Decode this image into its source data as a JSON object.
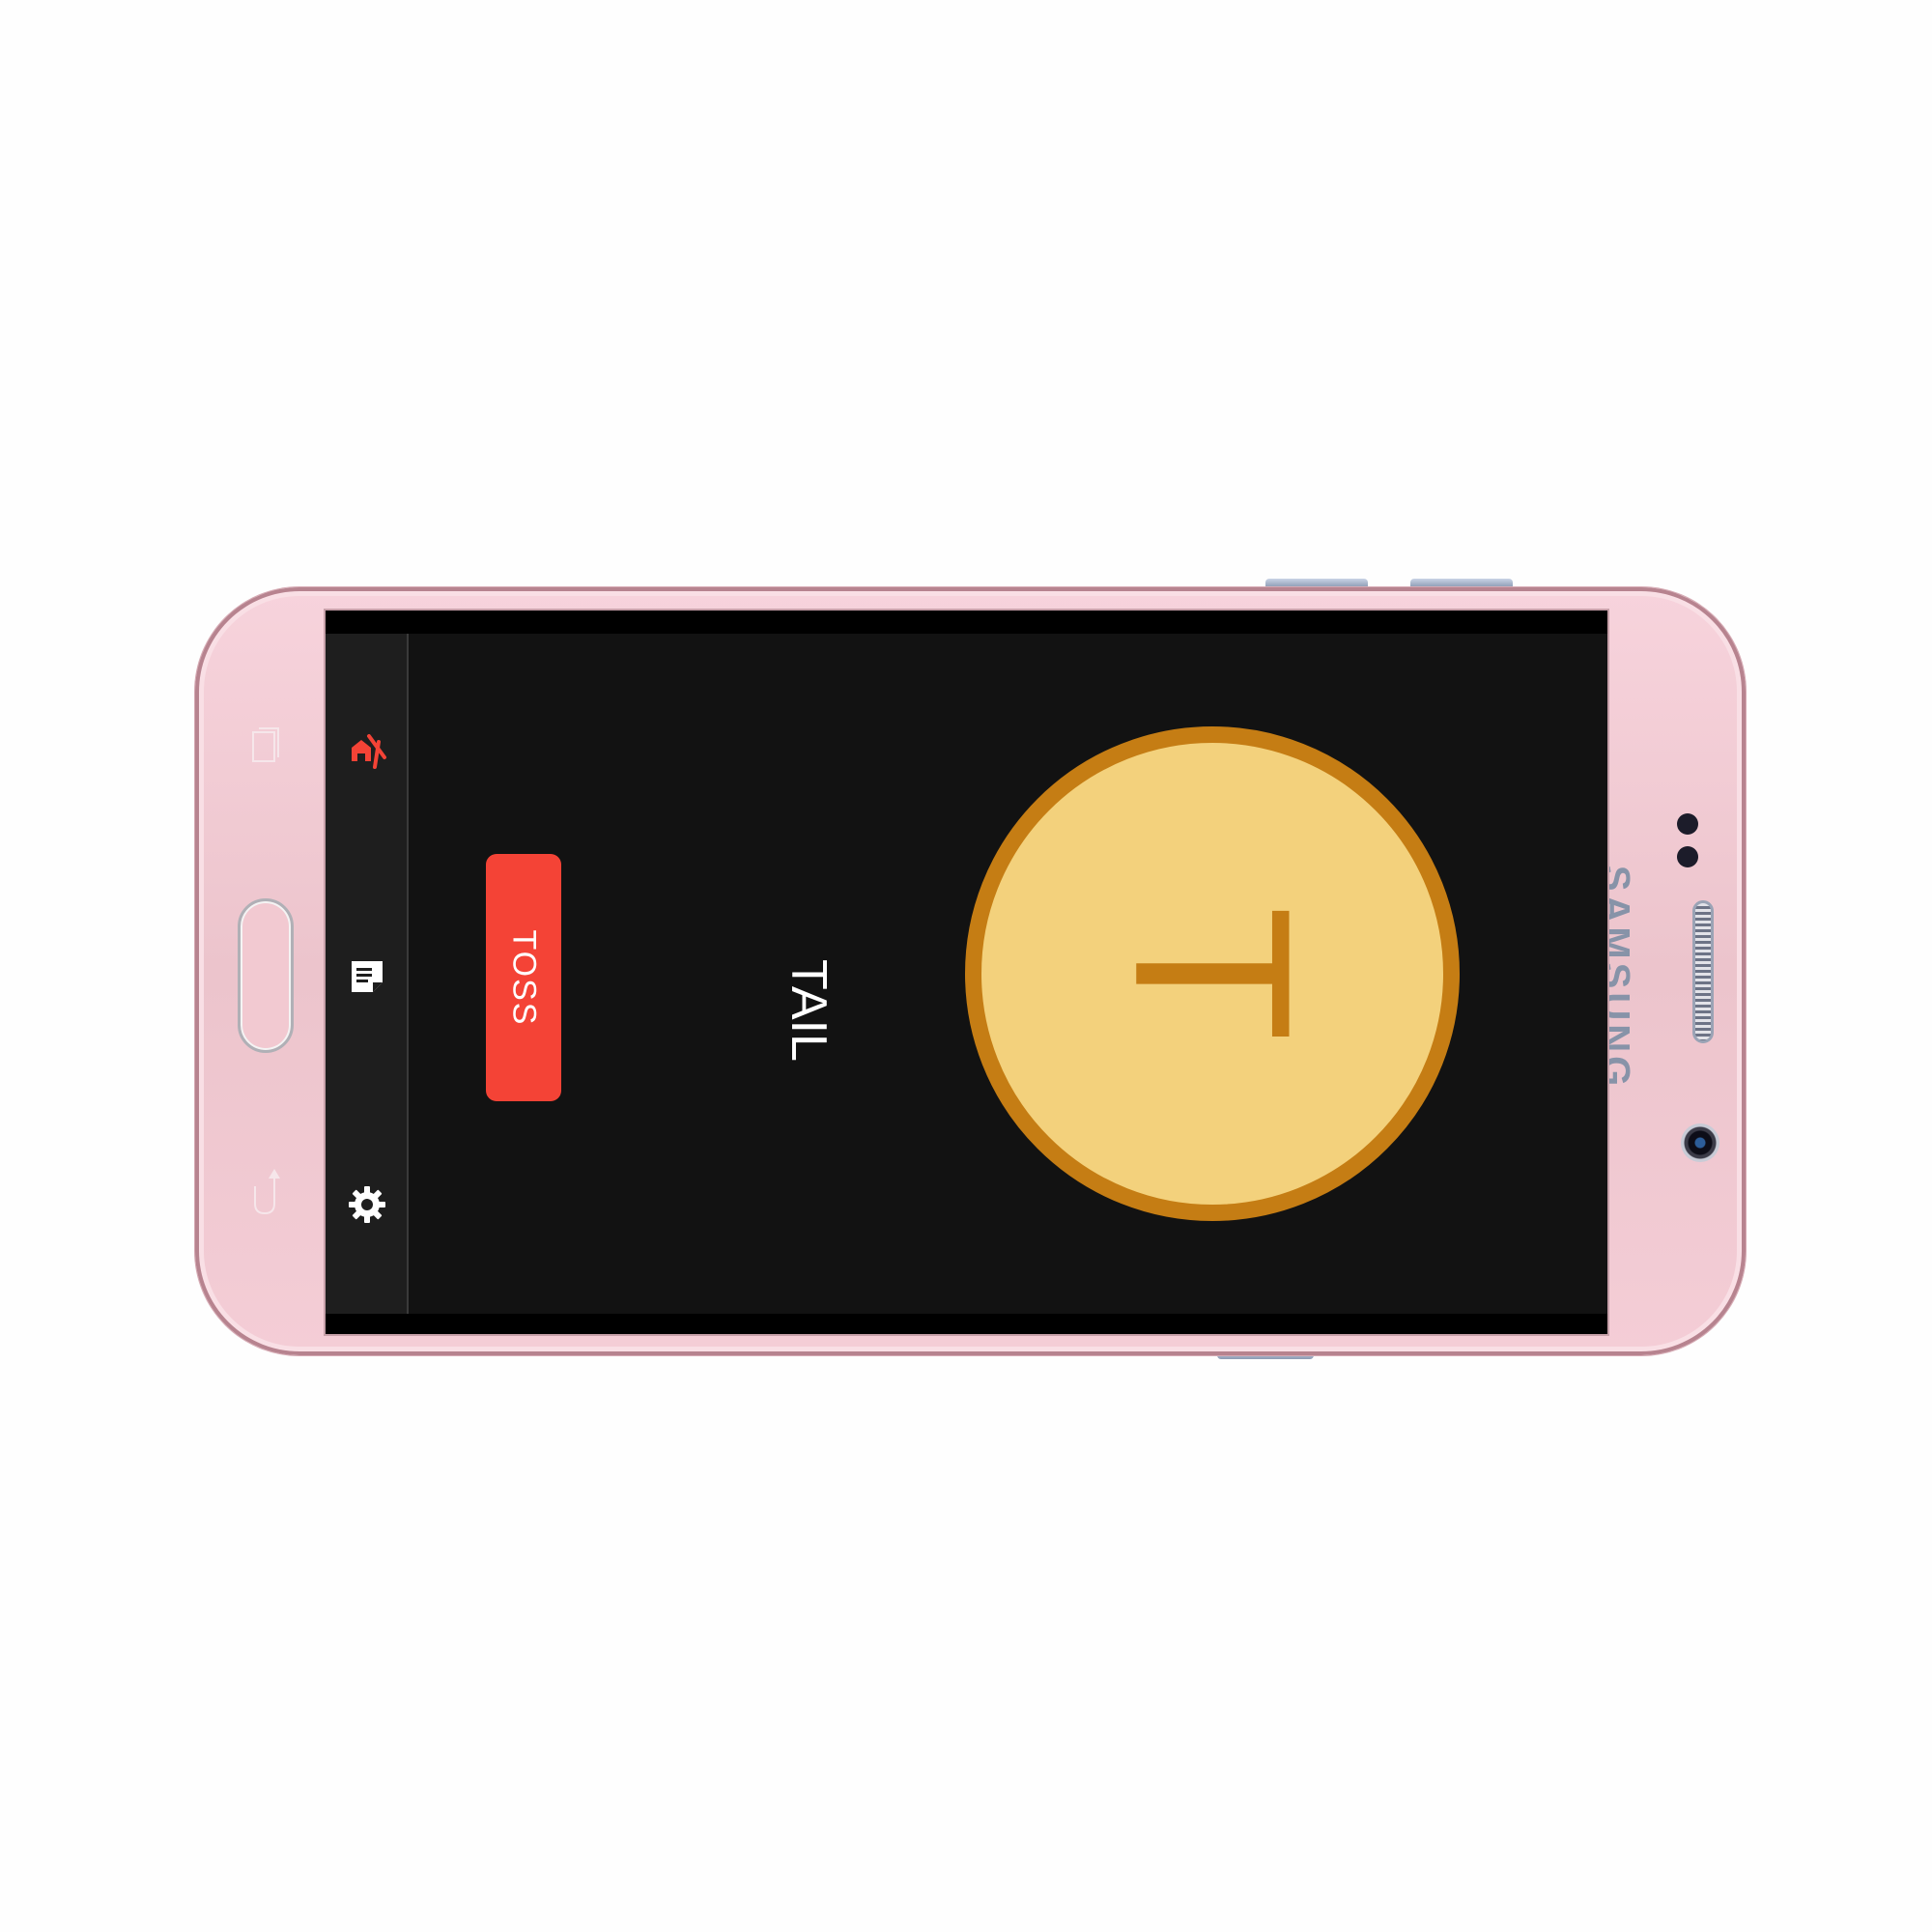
{
  "device": {
    "brand": "SAMSUNG",
    "color": "#f7d3dc"
  },
  "nav": {
    "items": [
      {
        "icon": "coin-toss-icon",
        "color": "#f44336",
        "active": true
      },
      {
        "icon": "history-icon",
        "color": "#ffffff",
        "active": false
      },
      {
        "icon": "gear-icon",
        "color": "#ffffff",
        "active": false
      }
    ]
  },
  "main": {
    "toss_label": "TOSS",
    "result_label": "TAIL",
    "coin_letter": "T"
  },
  "colors": {
    "background": "#121212",
    "accent": "#f44336",
    "coin_fill": "#f3d17c",
    "coin_rim": "#c57d14"
  }
}
